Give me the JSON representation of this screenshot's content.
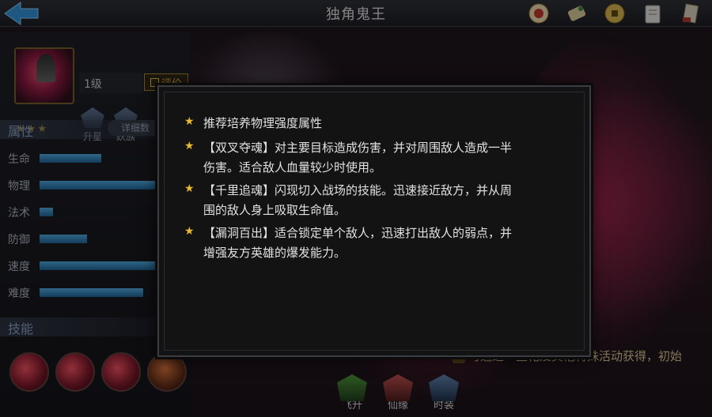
{
  "header": {
    "title": "独角鬼王",
    "top_icons": [
      "scroll-seal-icon",
      "map-scroll-icon",
      "coin-icon",
      "book-icon",
      "ledger-icon"
    ]
  },
  "hero": {
    "level": "1级",
    "stars": 3,
    "rate_label": "评价",
    "star_up_label": "升星",
    "race_label": "妖族"
  },
  "attributes": {
    "title": "属性",
    "detail_label": "详细数",
    "items": [
      {
        "name": "生命",
        "value": 0.52
      },
      {
        "name": "物理",
        "value": 1.0
      },
      {
        "name": "法术",
        "value": 0.11
      },
      {
        "name": "防御",
        "value": 0.4
      },
      {
        "name": "速度",
        "value": 1.0
      },
      {
        "name": "难度",
        "value": 0.87
      }
    ]
  },
  "skills": {
    "title": "技能"
  },
  "bottom": {
    "buttons": [
      "飞升",
      "仙缘",
      "时装"
    ],
    "obtain_text": "可通过一些化及其他特殊活动获得，初始"
  },
  "tips": {
    "items": [
      {
        "line1": "推荐培养物理强度属性"
      },
      {
        "line1": "【双叉夺魂】对主要目标造成伤害，并对周围敌人造成一半",
        "line2": "伤害。适合敌人血量较少时使用。"
      },
      {
        "line1": "【千里追魂】闪现切入战场的技能。迅速接近敌方，并从周",
        "line2": "围的敌人身上吸取生命值。"
      },
      {
        "line1": "【漏洞百出】适合锁定单个敌人，迅速打出敌人的弱点，并",
        "line2": "增强友方英雄的爆发能力。"
      }
    ]
  },
  "colors": {
    "accent_gold": "#e0b142",
    "bar_blue": "#2f7fb8",
    "star_gold": "#e8b935"
  }
}
